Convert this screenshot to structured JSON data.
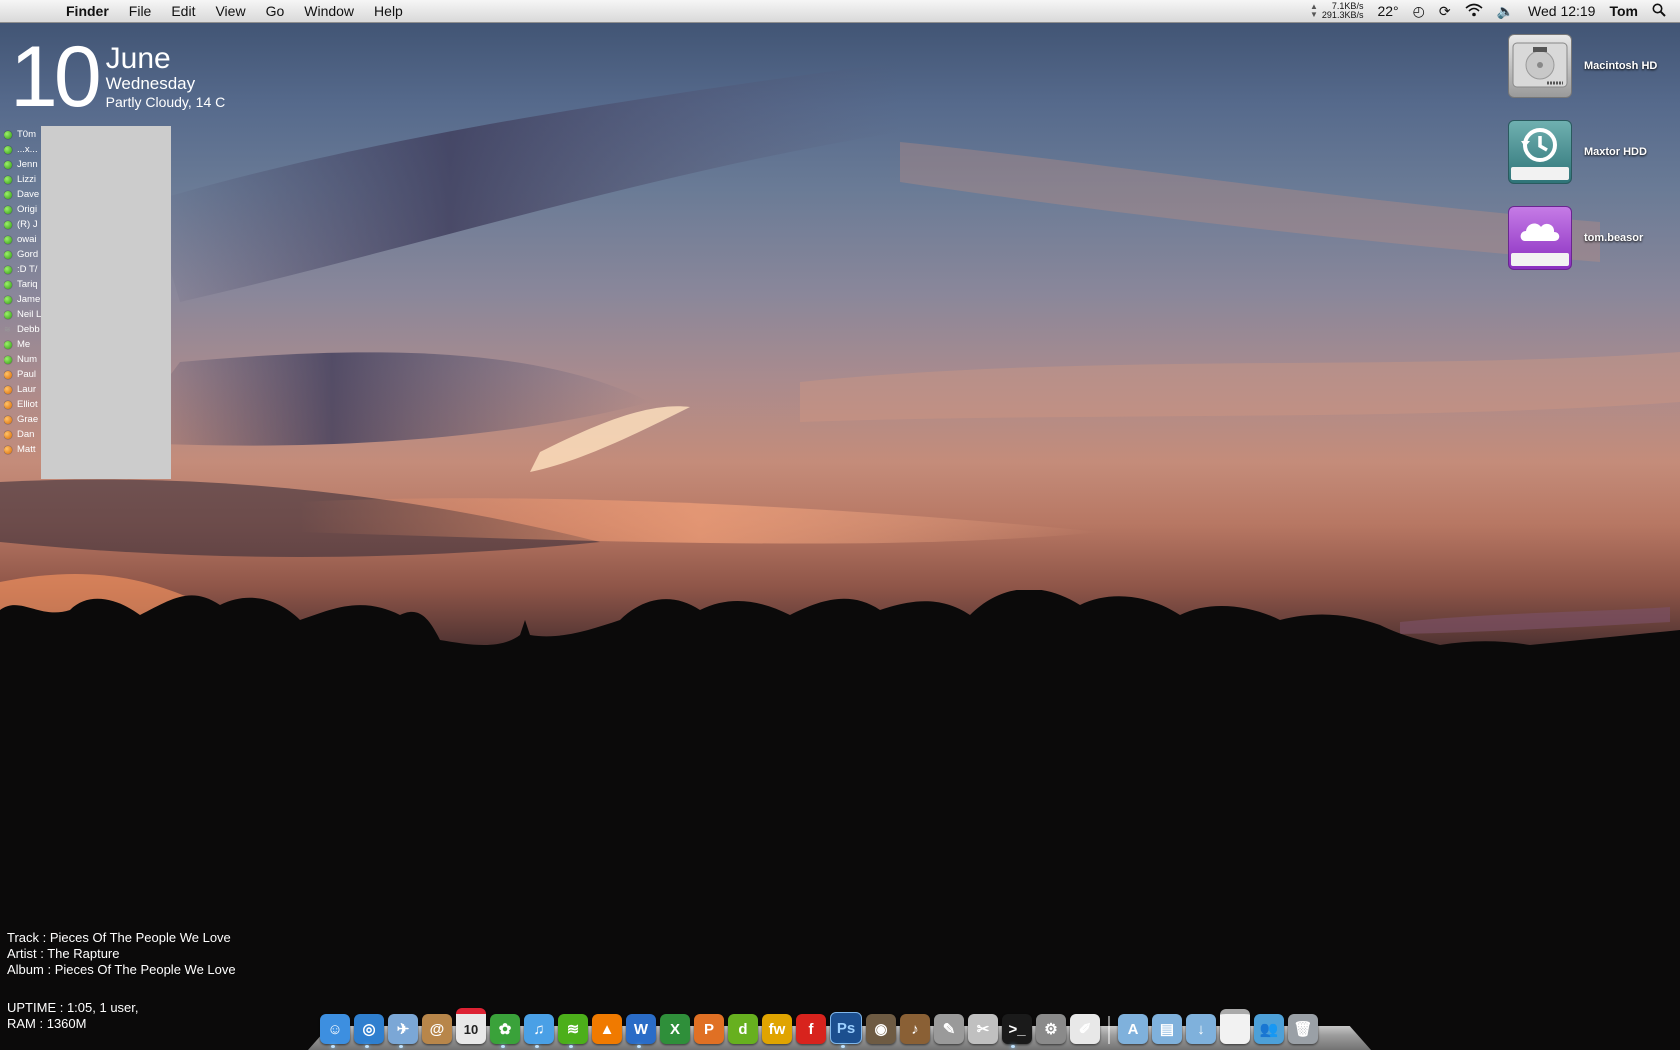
{
  "menubar": {
    "app": "Finder",
    "menus": [
      "File",
      "Edit",
      "View",
      "Go",
      "Window",
      "Help"
    ],
    "net_up": "7.1KB/s",
    "net_down": "291.3KB/s",
    "temperature": "22°",
    "clock": "Wed 12:19",
    "user": "Tom"
  },
  "date_widget": {
    "day": "10",
    "month": "June",
    "weekday": "Wednesday",
    "weather": "Partly Cloudy, 14 C"
  },
  "contacts": [
    {
      "name": "T0m",
      "status": "green"
    },
    {
      "name": "...x...",
      "status": "green"
    },
    {
      "name": "Jenn",
      "status": "green"
    },
    {
      "name": "Lizzi",
      "status": "green"
    },
    {
      "name": "Dave",
      "status": "green"
    },
    {
      "name": "Origi",
      "status": "green"
    },
    {
      "name": "(R) J",
      "status": "green"
    },
    {
      "name": "owai",
      "status": "green"
    },
    {
      "name": "Gord",
      "status": "green"
    },
    {
      "name": ":D T/",
      "status": "green"
    },
    {
      "name": "Tariq",
      "status": "green"
    },
    {
      "name": "Jame",
      "status": "green"
    },
    {
      "name": "Neil L",
      "status": "green"
    },
    {
      "name": "Debb",
      "status": "wifi"
    },
    {
      "name": "Me",
      "status": "green"
    },
    {
      "name": "Num",
      "status": "green"
    },
    {
      "name": "Paul",
      "status": "orange"
    },
    {
      "name": "Laur",
      "status": "orange"
    },
    {
      "name": "Elliot",
      "status": "orange"
    },
    {
      "name": "Grae",
      "status": "orange"
    },
    {
      "name": "Dan",
      "status": "orange"
    },
    {
      "name": "Matt",
      "status": "orange"
    }
  ],
  "desktop_icons": {
    "hd": "Macintosh HD",
    "maxtor": "Maxtor HDD",
    "icloud": "tom.beasor"
  },
  "music": {
    "track_label": "Track",
    "track": "Pieces Of The People We Love",
    "artist_label": "Artist",
    "artist": "The Rapture",
    "album_label": "Album",
    "album": "Pieces Of The People We Love"
  },
  "system": {
    "uptime": "UPTIME : 1:05, 1 user,",
    "ram": "RAM : 1360M"
  },
  "dock": {
    "calendar_day": "10",
    "photoshop_label": "Ps",
    "apps": [
      {
        "name": "finder",
        "color": "#3d8fe0",
        "glyph": "☺"
      },
      {
        "name": "safari",
        "color": "#2f7fcf",
        "glyph": "◎"
      },
      {
        "name": "mail",
        "color": "#7ba7d6",
        "glyph": "✈"
      },
      {
        "name": "address-book",
        "color": "#b8864a",
        "glyph": "@"
      },
      {
        "name": "ical",
        "color": "#e8e8e8",
        "glyph": ""
      },
      {
        "name": "adium",
        "color": "#3aa23a",
        "glyph": "✿"
      },
      {
        "name": "itunes",
        "color": "#4aa0e6",
        "glyph": "♫"
      },
      {
        "name": "spotify",
        "color": "#4caf1a",
        "glyph": "≋"
      },
      {
        "name": "vlc",
        "color": "#f07a00",
        "glyph": "▲"
      },
      {
        "name": "word",
        "color": "#2a6cc7",
        "glyph": "W"
      },
      {
        "name": "excel",
        "color": "#2f8f3a",
        "glyph": "X"
      },
      {
        "name": "powerpoint",
        "color": "#e07024",
        "glyph": "P"
      },
      {
        "name": "dreamweaver",
        "color": "#67b01f",
        "glyph": "d"
      },
      {
        "name": "fireworks",
        "color": "#e0a400",
        "glyph": "fw"
      },
      {
        "name": "flash",
        "color": "#d8231d",
        "glyph": "f"
      },
      {
        "name": "photoshop",
        "color": "#1c4f8f",
        "glyph": ""
      },
      {
        "name": "iphoto",
        "color": "#6e5b43",
        "glyph": "◉"
      },
      {
        "name": "garageband",
        "color": "#8a6035",
        "glyph": "♪"
      },
      {
        "name": "script-editor",
        "color": "#9a9a9a",
        "glyph": "✎"
      },
      {
        "name": "utility",
        "color": "#c0c0c0",
        "glyph": "✂"
      },
      {
        "name": "terminal",
        "color": "#1a1a1a",
        "glyph": ">_"
      },
      {
        "name": "system-preferences",
        "color": "#8a8a8a",
        "glyph": "⚙"
      },
      {
        "name": "textedit",
        "color": "#e8e8e8",
        "glyph": "✐"
      }
    ],
    "right": [
      {
        "name": "applications-folder",
        "color": "#7fb1dc",
        "glyph": "A"
      },
      {
        "name": "documents-folder",
        "color": "#7fb1dc",
        "glyph": "▤"
      },
      {
        "name": "downloads-folder",
        "color": "#7fb1dc",
        "glyph": "↓"
      },
      {
        "name": "window-stack",
        "color": "#f2f2f2",
        "glyph": ""
      },
      {
        "name": "messenger",
        "color": "#4da0d8",
        "glyph": "👥"
      },
      {
        "name": "trash",
        "color": "#9aa0a6",
        "glyph": "🗑"
      }
    ]
  }
}
